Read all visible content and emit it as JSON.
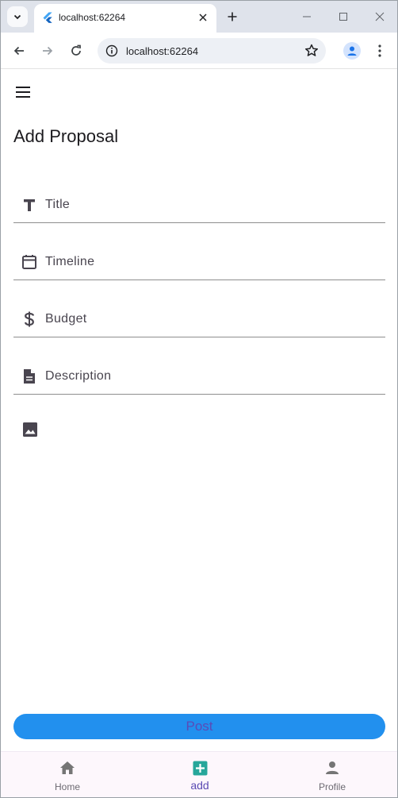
{
  "browser": {
    "tab_title": "localhost:62264",
    "url": "localhost:62264"
  },
  "page": {
    "title": "Add Proposal"
  },
  "form": {
    "title_placeholder": "Title",
    "timeline_placeholder": "Timeline",
    "budget_placeholder": "Budget",
    "description_placeholder": "Description",
    "post_label": "Post"
  },
  "bottom_nav": {
    "items": [
      {
        "label": "Home",
        "icon": "home-icon"
      },
      {
        "label": "add",
        "icon": "add-box-icon",
        "active": true
      },
      {
        "label": "Profile",
        "icon": "person-icon"
      }
    ]
  },
  "colors": {
    "accent": "#2290ee",
    "active_nav": "#5b4bb3",
    "add_icon": "#26a69a"
  }
}
